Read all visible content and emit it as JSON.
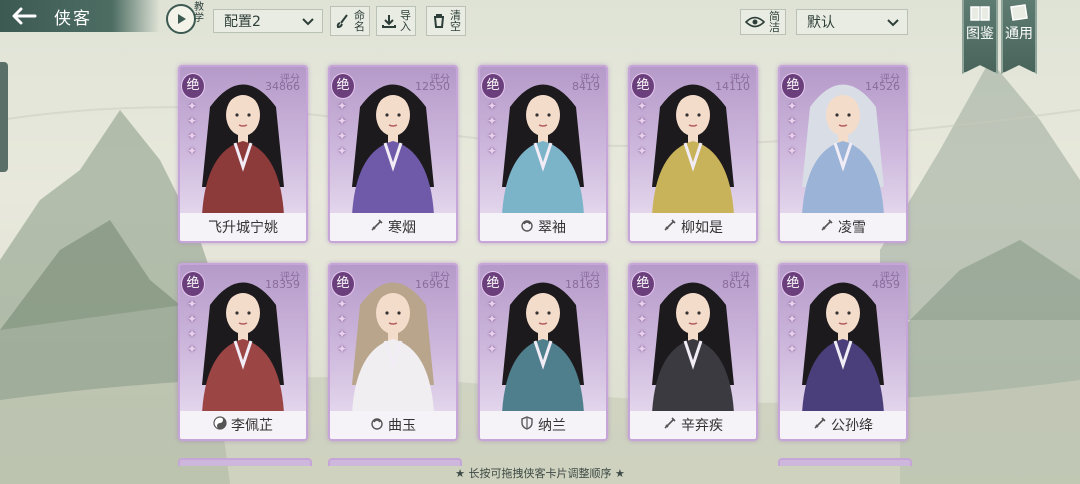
{
  "header": {
    "title": "侠客",
    "tutorial_label": "教学",
    "config_value": "配置2",
    "rename_label": "命名",
    "import_label": "导入",
    "clear_label": "清空",
    "filter_label": "简洁",
    "sort_value": "默认",
    "side_tabs": [
      {
        "label": "图鉴",
        "icon": "book-icon"
      },
      {
        "label": "通用",
        "icon": "scroll-icon"
      }
    ]
  },
  "cards": [
    {
      "name": "飞升城宁姚",
      "rank": "绝",
      "score_label": "评分",
      "score": "34866",
      "weapon_icon": "",
      "stars": 4,
      "robe": "#8c3a3a",
      "hair": "#1d1a1d"
    },
    {
      "name": "寒烟",
      "rank": "绝",
      "score_label": "评分",
      "score": "12550",
      "weapon_icon": "sword-icon",
      "stars": 4,
      "robe": "#6e5aa8",
      "hair": "#1d1a1d"
    },
    {
      "name": "翠袖",
      "rank": "绝",
      "score_label": "评分",
      "score": "8419",
      "weapon_icon": "palm-icon",
      "stars": 4,
      "robe": "#7bb3c9",
      "hair": "#1d1a1d"
    },
    {
      "name": "柳如是",
      "rank": "绝",
      "score_label": "评分",
      "score": "14110",
      "weapon_icon": "sword-icon",
      "stars": 4,
      "robe": "#c9b35a",
      "hair": "#1d1a1d"
    },
    {
      "name": "凌雪",
      "rank": "绝",
      "score_label": "评分",
      "score": "14526",
      "weapon_icon": "sword-icon",
      "stars": 4,
      "robe": "#9ab3d6",
      "hair": "#d9dde6"
    },
    {
      "name": "李佩芷",
      "rank": "绝",
      "score_label": "评分",
      "score": "18359",
      "weapon_icon": "yinyang-icon",
      "stars": 4,
      "robe": "#9b4545",
      "hair": "#1d1a1d"
    },
    {
      "name": "曲玉",
      "rank": "绝",
      "score_label": "评分",
      "score": "16961",
      "weapon_icon": "palm-icon",
      "stars": 4,
      "robe": "#f1eef2",
      "hair": "#b8a58c"
    },
    {
      "name": "纳兰",
      "rank": "绝",
      "score_label": "评分",
      "score": "18163",
      "weapon_icon": "shield-icon",
      "stars": 4,
      "robe": "#4f7f8c",
      "hair": "#1d1a1d"
    },
    {
      "name": "辛弃疾",
      "rank": "绝",
      "score_label": "评分",
      "score": "8614",
      "weapon_icon": "sword-icon",
      "stars": 4,
      "robe": "#3a3a40",
      "hair": "#1d1a1d"
    },
    {
      "name": "公孙绛",
      "rank": "绝",
      "score_label": "评分",
      "score": "4859",
      "weapon_icon": "sword-icon",
      "stars": 4,
      "robe": "#4a3f7a",
      "hair": "#1d1a1d"
    }
  ],
  "footer_hint": "★ 长按可拖拽侠客卡片调整顺序 ★"
}
